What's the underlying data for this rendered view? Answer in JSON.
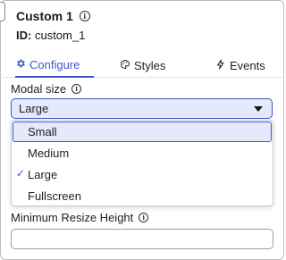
{
  "component": {
    "title": "Custom 1",
    "id_label": "ID:",
    "id_value": "custom_1"
  },
  "tabs": [
    {
      "label": "Configure",
      "icon": "gear-icon",
      "active": true
    },
    {
      "label": "Styles",
      "icon": "palette-icon",
      "active": false
    },
    {
      "label": "Events",
      "icon": "lightning-icon",
      "active": false
    }
  ],
  "modal_size": {
    "label": "Modal size",
    "selected": "Large",
    "options": [
      {
        "label": "Small",
        "highlighted": true,
        "checked": false
      },
      {
        "label": "Medium",
        "highlighted": false,
        "checked": false
      },
      {
        "label": "Large",
        "highlighted": false,
        "checked": true
      },
      {
        "label": "Fullscreen",
        "highlighted": false,
        "checked": false
      }
    ]
  },
  "min_resize_height": {
    "label": "Minimum Resize Height",
    "value": "",
    "placeholder": ""
  },
  "colors": {
    "accent": "#3d57c9",
    "selected_bg": "#e4e9fb",
    "border": "#bdbdbd"
  }
}
